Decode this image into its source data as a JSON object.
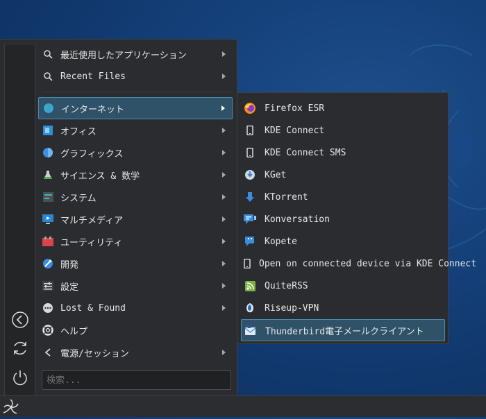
{
  "menu": {
    "items": [
      {
        "label": "最近使用したアプリケーション",
        "icon": "search-icon",
        "submenu": true
      },
      {
        "label": "Recent Files",
        "icon": "search-icon",
        "submenu": true
      },
      {
        "label": "インターネット",
        "icon": "globe-icon",
        "submenu": true,
        "active": true
      },
      {
        "label": "オフィス",
        "icon": "office-icon",
        "submenu": true
      },
      {
        "label": "グラフィックス",
        "icon": "graphics-icon",
        "submenu": true
      },
      {
        "label": "サイエンス & 数学",
        "icon": "science-icon",
        "submenu": true
      },
      {
        "label": "システム",
        "icon": "system-icon",
        "submenu": true
      },
      {
        "label": "マルチメディア",
        "icon": "multimedia-icon",
        "submenu": true
      },
      {
        "label": "ユーティリティ",
        "icon": "utilities-icon",
        "submenu": true
      },
      {
        "label": "開発",
        "icon": "development-icon",
        "submenu": true
      },
      {
        "label": "設定",
        "icon": "settings-icon",
        "submenu": true
      },
      {
        "label": "Lost & Found",
        "icon": "lost-found-icon",
        "submenu": true
      },
      {
        "label": "ヘルプ",
        "icon": "help-icon",
        "submenu": false
      },
      {
        "label": "電源/セッション",
        "icon": "chevron-left-icon",
        "submenu": true
      }
    ],
    "search_placeholder": "検索...",
    "side_buttons": [
      "back-icon",
      "refresh-icon",
      "power-icon"
    ]
  },
  "submenu": {
    "title": "インターネット",
    "items": [
      {
        "label": "Firefox ESR",
        "icon": "firefox-icon"
      },
      {
        "label": "KDE Connect",
        "icon": "phone-icon"
      },
      {
        "label": "KDE Connect SMS",
        "icon": "phone-icon"
      },
      {
        "label": "KGet",
        "icon": "kget-icon"
      },
      {
        "label": "KTorrent",
        "icon": "ktorrent-icon"
      },
      {
        "label": "Konversation",
        "icon": "konversation-icon"
      },
      {
        "label": "Kopete",
        "icon": "kopete-icon"
      },
      {
        "label": "Open on connected device via KDE Connect",
        "icon": "phone-icon"
      },
      {
        "label": "QuiteRSS",
        "icon": "rss-icon"
      },
      {
        "label": "Riseup-VPN",
        "icon": "vpn-icon"
      },
      {
        "label": "Thunderbird電子メールクライアント",
        "icon": "thunderbird-icon",
        "active": true
      }
    ]
  },
  "taskbar": {
    "launcher_icon": "app-launcher-icon"
  },
  "colors": {
    "highlight": "#2f5268",
    "highlight_border": "#4a8cb4",
    "menu_bg": "#2a2c2f"
  }
}
